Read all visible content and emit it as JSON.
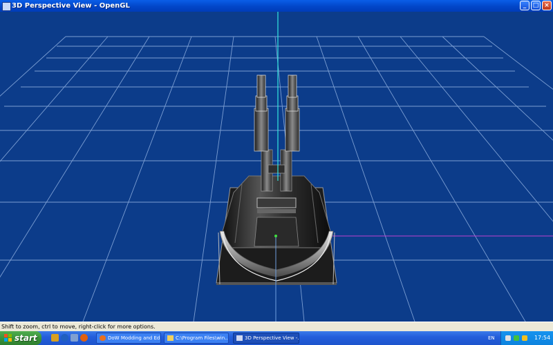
{
  "window": {
    "title": "3D Perspective View - OpenGL",
    "minimize_label": "_",
    "maximize_label": "□",
    "close_label": "×"
  },
  "statusbar": {
    "text": "Shift to zoom, ctrl to move, right-click for more options."
  },
  "taskbar": {
    "start_label": "start",
    "tasks": [
      {
        "label": "DoW Modding and Edi...",
        "icon": "firefox-icon",
        "active": false
      },
      {
        "label": "C:\\Program Files\\win...",
        "icon": "explorer-icon",
        "active": false
      },
      {
        "label": "3D Perspective View -...",
        "icon": "app-window-icon",
        "active": true
      }
    ],
    "language": "EN",
    "clock": "17:54"
  },
  "colors": {
    "viewport_background": "#0c3c8a",
    "grid": "#8fb0e0",
    "axis_vertical": "#33e8e0",
    "axis_horizontal": "#c040d0"
  }
}
